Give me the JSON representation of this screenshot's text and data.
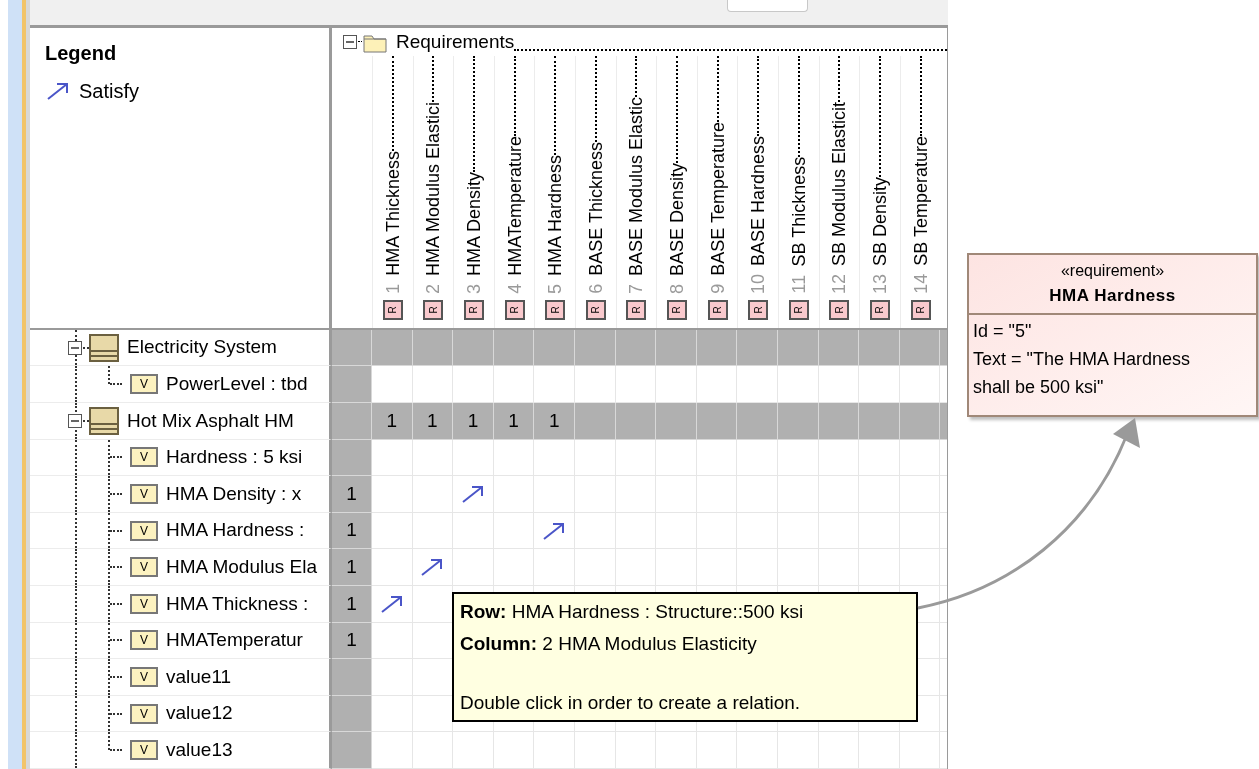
{
  "legend": {
    "title": "Legend",
    "items": [
      {
        "label": "Satisfy"
      }
    ]
  },
  "requirements_group": {
    "label": "Requirements",
    "expanded": true
  },
  "columns": [
    {
      "number": "1",
      "name": "HMA Thickness",
      "icon_text": "R"
    },
    {
      "number": "2",
      "name": "HMA Modulus Elastici",
      "icon_text": "R"
    },
    {
      "number": "3",
      "name": "HMA Density",
      "icon_text": "R"
    },
    {
      "number": "4",
      "name": "HMATemperature",
      "icon_text": "R"
    },
    {
      "number": "5",
      "name": "HMA Hardness",
      "icon_text": "R"
    },
    {
      "number": "6",
      "name": "BASE Thickness",
      "icon_text": "R"
    },
    {
      "number": "7",
      "name": "BASE Modulus Elastic",
      "icon_text": "R"
    },
    {
      "number": "8",
      "name": "BASE Density",
      "icon_text": "R"
    },
    {
      "number": "9",
      "name": "BASE Temperature",
      "icon_text": "R"
    },
    {
      "number": "10",
      "name": "BASE Hardness",
      "icon_text": "R"
    },
    {
      "number": "11",
      "name": "SB Thickness",
      "icon_text": "R"
    },
    {
      "number": "12",
      "name": "SB Modulus Elasticit",
      "icon_text": "R"
    },
    {
      "number": "13",
      "name": "SB Density",
      "icon_text": "R"
    },
    {
      "number": "14",
      "name": "SB Temperature",
      "icon_text": "R"
    }
  ],
  "tree": [
    {
      "label": "Electricity System",
      "kind": "block",
      "expanded": true,
      "children": [
        {
          "label": "PowerLevel : tbd",
          "kind": "value",
          "icon_text": "V"
        }
      ]
    },
    {
      "label": "Hot Mix Asphalt HM",
      "kind": "block",
      "expanded": true,
      "cells": [
        {
          "kind": "count",
          "text": "1"
        },
        {
          "kind": "count",
          "text": "1"
        },
        {
          "kind": "count",
          "text": "1"
        },
        {
          "kind": "count",
          "text": "1"
        },
        {
          "kind": "count",
          "text": "1"
        }
      ],
      "children": [
        {
          "label": "Hardness : 5 ksi",
          "kind": "value",
          "icon_text": "V"
        },
        {
          "label": "HMA Density : x",
          "kind": "value",
          "icon_text": "V",
          "count": "1",
          "cells": [
            {
              "kind": "blank"
            },
            {
              "kind": "blank"
            },
            {
              "kind": "satisfy"
            }
          ]
        },
        {
          "label": "HMA Hardness :",
          "kind": "value",
          "icon_text": "V",
          "count": "1",
          "cells": [
            {
              "kind": "blank"
            },
            {
              "kind": "blank"
            },
            {
              "kind": "blank"
            },
            {
              "kind": "blank"
            },
            {
              "kind": "satisfy"
            }
          ]
        },
        {
          "label": "HMA Modulus Ela",
          "kind": "value",
          "icon_text": "V",
          "count": "1",
          "cells": [
            {
              "kind": "blank"
            },
            {
              "kind": "satisfy"
            }
          ]
        },
        {
          "label": "HMA Thickness :",
          "kind": "value",
          "icon_text": "V",
          "count": "1",
          "cells": [
            {
              "kind": "satisfy"
            }
          ]
        },
        {
          "label": "HMATemperatur",
          "kind": "value",
          "icon_text": "V",
          "count": "1"
        },
        {
          "label": "value11",
          "kind": "value",
          "icon_text": "V"
        },
        {
          "label": "value12",
          "kind": "value",
          "icon_text": "V"
        },
        {
          "label": "value13",
          "kind": "value",
          "icon_text": "V"
        }
      ]
    }
  ],
  "tooltip": {
    "lines": [
      "**Row:** HMA Hardness : Structure::500 ksi",
      "**Column:** 2 HMA Modulus Elasticity",
      "Double click in order to create a relation."
    ]
  },
  "requirement_note": {
    "stereotype": "«requirement»",
    "name": "HMA Hardness",
    "properties": [
      "Id = \"5\"",
      "Text = \"The HMA Hardness shall be 500 ksi\""
    ]
  }
}
